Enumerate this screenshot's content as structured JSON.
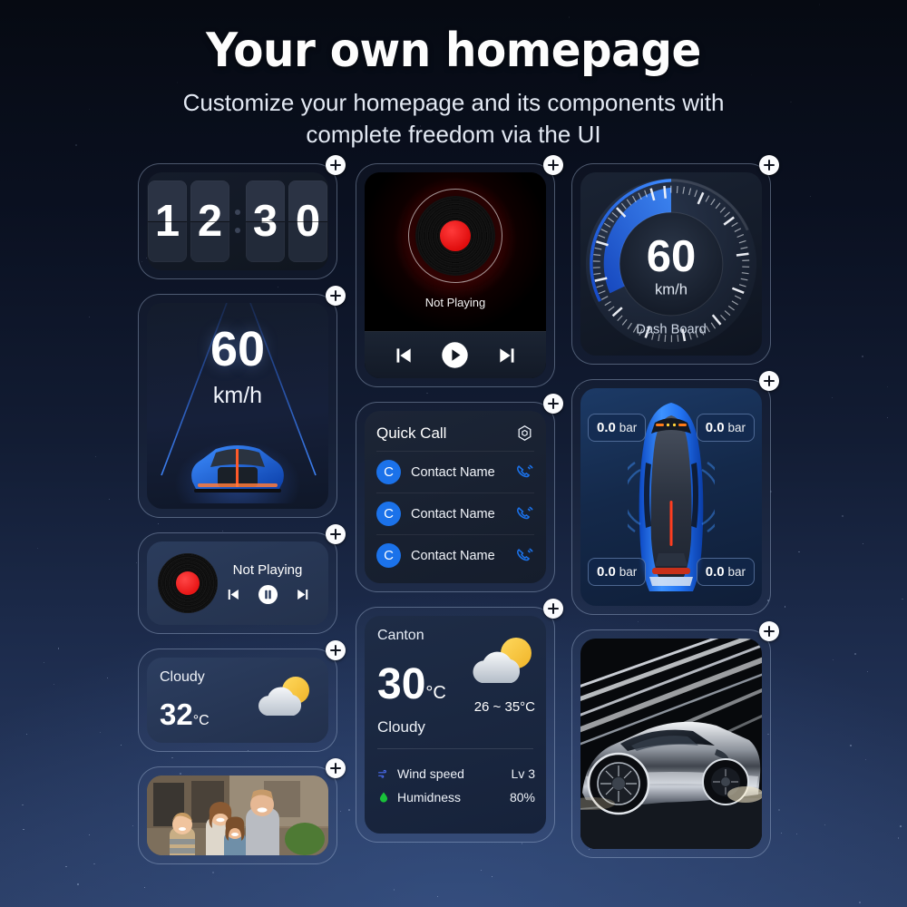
{
  "header": {
    "title": "Your own homepage",
    "subtitle_line1": "Customize your homepage and its components with",
    "subtitle_line2": "complete freedom via the UI"
  },
  "colors": {
    "accent_blue": "#1b72ea",
    "glow_blue": "#2f6fff",
    "vinyl_red": "#e81616",
    "humidity_green": "#19c23a",
    "sun_yellow": "#f7c948",
    "bg_top": "#060a12",
    "bg_bottom": "#2b3e66"
  },
  "add_button_label": "+",
  "widgets": {
    "clock": {
      "name": "Flip Clock",
      "digits": [
        "1",
        "2",
        "3",
        "0"
      ],
      "time_display": "12:30"
    },
    "music_player_large": {
      "name": "Music Player",
      "status": "Not Playing",
      "controls": [
        "previous",
        "play",
        "next"
      ]
    },
    "dash_board": {
      "name": "Dash Board",
      "value": "60",
      "unit": "km/h",
      "label": "Dash Board",
      "arc_percent": 22
    },
    "hud": {
      "name": "Head Up Display",
      "value": "60",
      "unit": "km/h"
    },
    "quick_call": {
      "title": "Quick Call",
      "settings_icon": "hexagon-gear-icon",
      "contacts": [
        {
          "initial": "C",
          "name": "Contact Name"
        },
        {
          "initial": "C",
          "name": "Contact Name"
        },
        {
          "initial": "C",
          "name": "Contact Name"
        }
      ]
    },
    "tire_pressure": {
      "name": "Tire Pressure",
      "front_left": "0.0",
      "front_right": "0.0",
      "rear_left": "0.0",
      "rear_right": "0.0",
      "unit": "bar"
    },
    "music_player_small": {
      "name": "Music Player Compact",
      "status": "Not Playing",
      "controls": [
        "previous",
        "pause",
        "next"
      ]
    },
    "weather_small": {
      "condition": "Cloudy",
      "temperature": "32",
      "unit": "°C",
      "icon": "sun-behind-cloud-icon"
    },
    "weather_large": {
      "city": "Canton",
      "temperature": "30",
      "unit": "°C",
      "range": "26 ~ 35°C",
      "condition": "Cloudy",
      "icon": "sun-behind-cloud-icon",
      "details": [
        {
          "icon": "wind-icon",
          "label": "Wind speed",
          "value": "Lv 3"
        },
        {
          "icon": "humidity-drop-icon",
          "label": "Humidness",
          "value": "80%"
        }
      ]
    },
    "photo": {
      "name": "Family Photo",
      "alt": "family of four smiling outdoors"
    },
    "car_photo": {
      "name": "Car Photo",
      "alt": "chrome sports car with light streaks"
    }
  }
}
